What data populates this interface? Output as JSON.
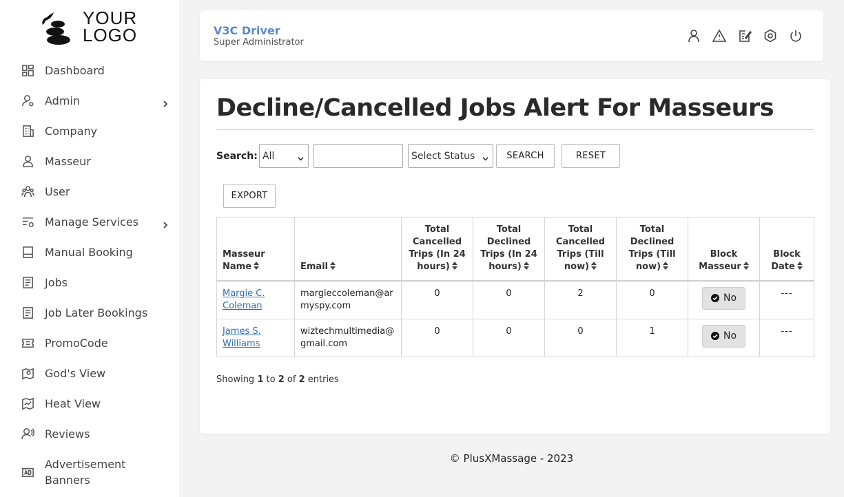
{
  "logo": {
    "text_line1": "YOUR",
    "text_line2": "LOGO"
  },
  "sidebar": {
    "items": [
      {
        "label": "Dashboard",
        "icon": "dashboard-icon"
      },
      {
        "label": "Admin",
        "icon": "admin-user-icon",
        "has_submenu": true
      },
      {
        "label": "Company",
        "icon": "building-icon"
      },
      {
        "label": "Masseur",
        "icon": "person-icon"
      },
      {
        "label": "User",
        "icon": "users-icon"
      },
      {
        "label": "Manage Services",
        "icon": "settings-list-icon",
        "has_submenu": true
      },
      {
        "label": "Manual Booking",
        "icon": "booking-icon"
      },
      {
        "label": "Jobs",
        "icon": "document-icon"
      },
      {
        "label": "Job Later Bookings",
        "icon": "document-icon"
      },
      {
        "label": "PromoCode",
        "icon": "ticket-icon"
      },
      {
        "label": "God's View",
        "icon": "map-pin-icon"
      },
      {
        "label": "Heat View",
        "icon": "map-icon"
      },
      {
        "label": "Reviews",
        "icon": "reviews-icon"
      },
      {
        "label": "Advertisement Banners",
        "icon": "ad-icon"
      }
    ]
  },
  "header": {
    "title": "V3C Driver",
    "subtitle": "Super Administrator",
    "icons": [
      "profile-icon",
      "alert-icon",
      "edit-note-icon",
      "settings-icon",
      "power-icon"
    ]
  },
  "main": {
    "title": "Decline/Cancelled Jobs Alert For Masseurs",
    "search": {
      "label": "Search:",
      "field_select_value": "All",
      "input_value": "",
      "status_select_value": "Select Status",
      "search_button": "SEARCH",
      "reset_button": "RESET"
    },
    "export_button": "EXPORT",
    "table": {
      "headers": {
        "name": "Masseur Name",
        "email": "Email",
        "cancelled_24": "Total Cancelled Trips (In 24 hours)",
        "declined_24": "Total Declined Trips (In 24 hours)",
        "cancelled_all": "Total Cancelled Trips (Till now)",
        "declined_all": "Total Declined Trips (Till now)",
        "block": "Block Masseur",
        "block_date": "Block Date"
      },
      "rows": [
        {
          "name": "Margie C. Coleman",
          "email": "margieccoleman@armyspy.com",
          "cancelled_24": "0",
          "declined_24": "0",
          "cancelled_all": "2",
          "declined_all": "0",
          "block": "No",
          "block_date": "---"
        },
        {
          "name": "James S. Williams",
          "email": "wiztechmultimedia@gmail.com",
          "cancelled_24": "0",
          "declined_24": "0",
          "cancelled_all": "0",
          "declined_all": "1",
          "block": "No",
          "block_date": "---"
        }
      ]
    },
    "showing": {
      "prefix": "Showing",
      "from": "1",
      "to_word": "to",
      "to": "2",
      "of_word": "of",
      "total": "2",
      "suffix": "entries"
    }
  },
  "footer": {
    "text": "© PlusXMassage - 2023"
  },
  "colors": {
    "accent": "#5b8ac7",
    "link": "#2f6fb5",
    "background": "#f3f3f3"
  }
}
